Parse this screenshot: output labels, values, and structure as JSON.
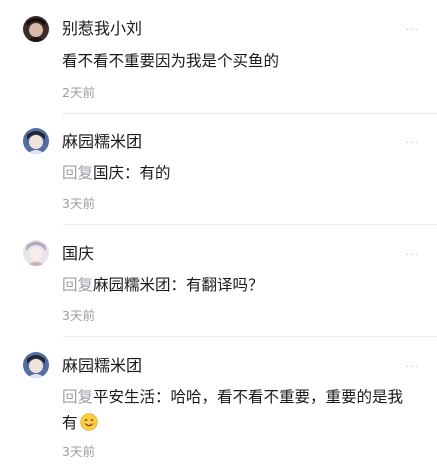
{
  "comments": [
    {
      "username": "别惹我小刘",
      "content": "看不看不重要因为我是个买鱼的",
      "time": "2天前",
      "more": "···"
    },
    {
      "username": "麻园糯米团",
      "reply_prefix": "回复",
      "reply_to": "国庆",
      "content": "：有的",
      "time": "3天前",
      "more": "···"
    },
    {
      "username": "国庆",
      "reply_prefix": "回复",
      "reply_to": "麻园糯米团",
      "content": "：有翻译吗？",
      "time": "3天前",
      "more": "···"
    },
    {
      "username": "麻园糯米团",
      "reply_prefix": "回复",
      "reply_to": "平安生活",
      "content": "：哈哈，看不看不重要，重要的是我有",
      "emoji": "smiling-face-emoji",
      "time": "3天前",
      "more": "···"
    }
  ]
}
